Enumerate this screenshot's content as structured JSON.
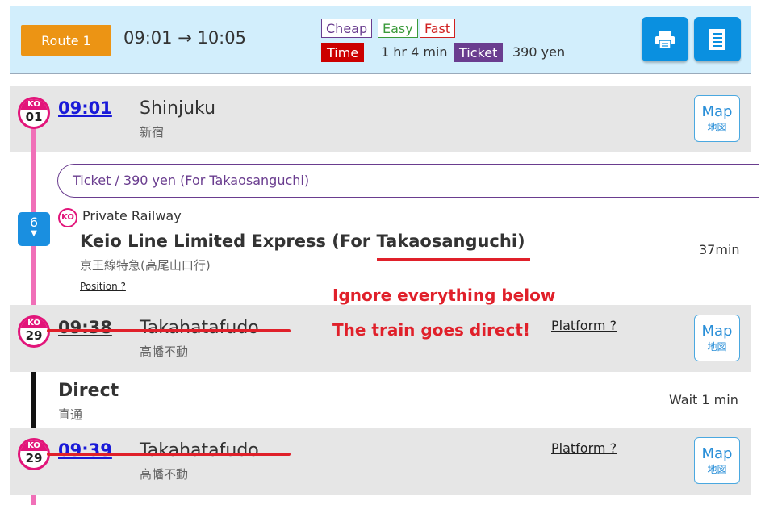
{
  "header": {
    "route_label": "Route 1",
    "time_range": "09:01 → 10:05",
    "tags": {
      "cheap": "Cheap",
      "easy": "Easy",
      "fast": "Fast"
    },
    "time_badge": "Time",
    "duration": "1 hr 4 min",
    "ticket_badge": "Ticket",
    "fare": "390 yen",
    "icons": [
      "printer-icon",
      "document-icon"
    ]
  },
  "stations": [
    {
      "code": "KO",
      "number": "01",
      "time": "09:01",
      "name": "Shinjuku",
      "name_jp": "新宿",
      "map_label": "Map",
      "map_jp": "地図"
    },
    {
      "code": "KO",
      "number": "29",
      "time": "09:38",
      "name": "Takahatafudo",
      "name_jp": "高幡不動",
      "platform": "Platform ?",
      "map_label": "Map",
      "map_jp": "地図"
    },
    {
      "code": "KO",
      "number": "29",
      "time": "09:39",
      "name": "Takahatafudo",
      "name_jp": "高幡不動",
      "platform": "Platform ?",
      "map_label": "Map",
      "map_jp": "地図"
    }
  ],
  "ticket": {
    "text": "Ticket / 390 yen (For Takaosanguchi)"
  },
  "segment": {
    "stop_count": "6",
    "operator_code": "KO",
    "railway_type": "Private Railway",
    "train_name": "Keio Line Limited Express (For Takaosanguchi)",
    "train_name_jp": "京王線特急(高尾山口行)",
    "duration": "37min",
    "position_link": "Position ?"
  },
  "transfer": {
    "label": "Direct",
    "label_jp": "直通",
    "wait": "Wait 1 min"
  },
  "annotations": {
    "line1": "Ignore everything below",
    "line2": "The train goes direct!"
  },
  "colors": {
    "route_orange": "#ec9414",
    "header_bg": "#d2eefc",
    "keio_pink": "#e2157a",
    "annotation_red": "#e0202a",
    "ticket_purple": "#6a3d8f",
    "time_red": "#cc0000",
    "button_blue": "#0a90e0"
  }
}
